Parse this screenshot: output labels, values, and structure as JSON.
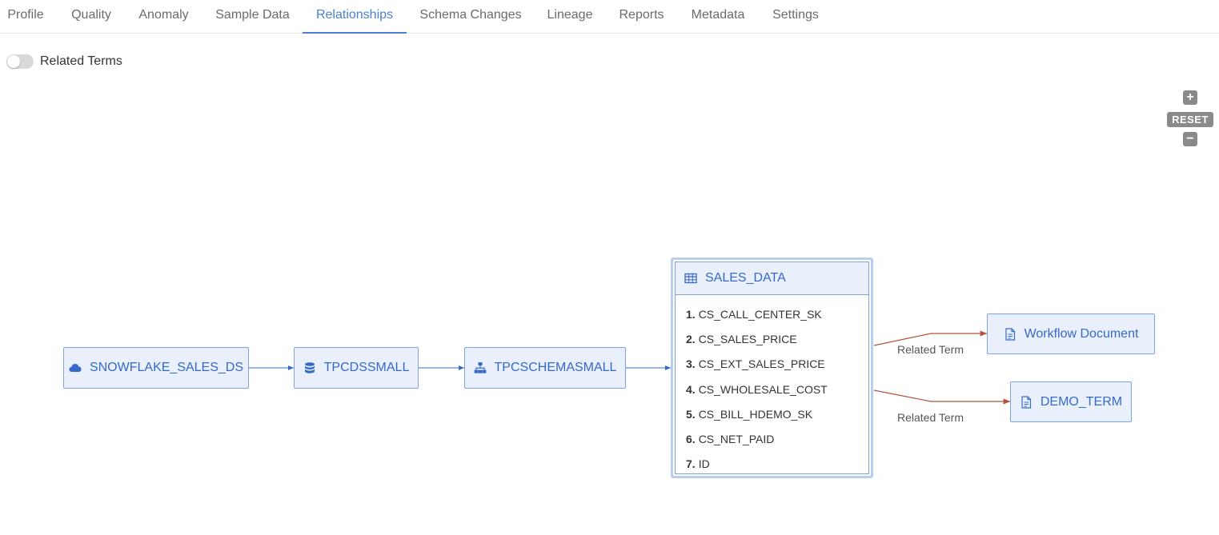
{
  "tabs": [
    {
      "label": "Profile"
    },
    {
      "label": "Quality"
    },
    {
      "label": "Anomaly"
    },
    {
      "label": "Sample Data"
    },
    {
      "label": "Relationships"
    },
    {
      "label": "Schema Changes"
    },
    {
      "label": "Lineage"
    },
    {
      "label": "Reports"
    },
    {
      "label": "Metadata"
    },
    {
      "label": "Settings"
    }
  ],
  "active_tab": "Relationships",
  "toggle": {
    "label": "Related Terms",
    "on": false
  },
  "zoom": {
    "zoom_in": "+",
    "reset": "RESET",
    "zoom_out": "−"
  },
  "graph": {
    "nodes": [
      {
        "label": "SNOWFLAKE_SALES_DS",
        "icon": "cloud-icon"
      },
      {
        "label": "TPCDSSMALL",
        "icon": "database-icon"
      },
      {
        "label": "TPCSCHEMASMALL",
        "icon": "hierarchy-icon"
      }
    ],
    "table": {
      "label": "SALES_DATA",
      "icon": "table-icon",
      "columns": [
        {
          "num": "1.",
          "name": "CS_CALL_CENTER_SK"
        },
        {
          "num": "2.",
          "name": "CS_SALES_PRICE"
        },
        {
          "num": "3.",
          "name": "CS_EXT_SALES_PRICE"
        },
        {
          "num": "4.",
          "name": "CS_WHOLESALE_COST"
        },
        {
          "num": "5.",
          "name": "CS_BILL_HDEMO_SK"
        },
        {
          "num": "6.",
          "name": "CS_NET_PAID"
        },
        {
          "num": "7.",
          "name": "ID"
        }
      ]
    },
    "terms": [
      {
        "label": "Workflow Document",
        "icon": "document-icon",
        "edge_label": "Related Term"
      },
      {
        "label": "DEMO_TERM",
        "icon": "document-icon",
        "edge_label": "Related Term"
      }
    ]
  },
  "colors": {
    "accent": "#4a80d4",
    "node_bg": "#eaf0fb",
    "node_border": "#7fa3e0",
    "term_edge": "#b5533c"
  }
}
